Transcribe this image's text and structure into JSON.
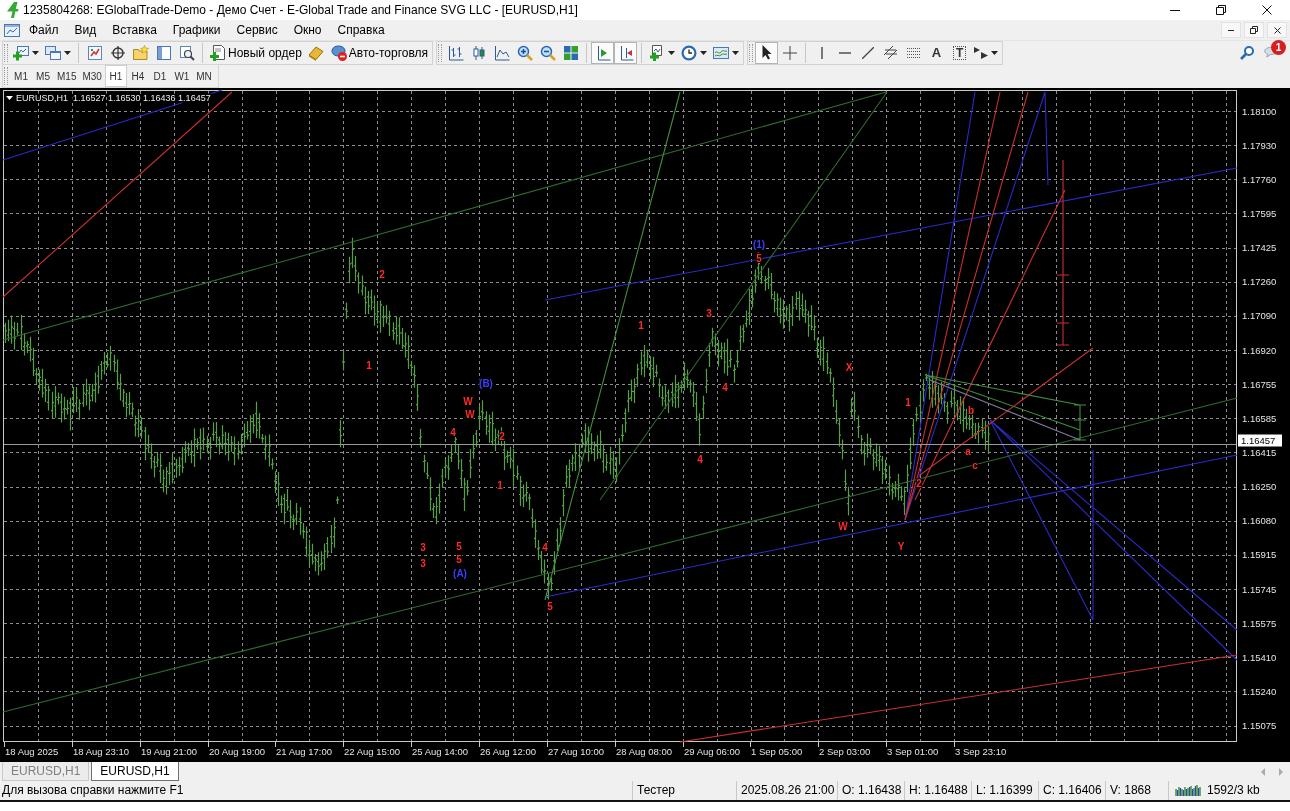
{
  "window": {
    "title": "1235804268: EGlobalTrade-Demo - Демо Счет - E-Global Trade and Finance SVG LLC - [EURUSD,H1]"
  },
  "menu": [
    "Файл",
    "Вид",
    "Вставка",
    "Графики",
    "Сервис",
    "Окно",
    "Справка"
  ],
  "toolbars": [
    {
      "groups": [
        [
          {
            "kind": "dropdown",
            "pressed": false
          },
          {
            "kind": "dropdown",
            "pressed": false
          }
        ],
        [
          {
            "kind": "icon",
            "pressed": false
          },
          {
            "kind": "icon",
            "pressed": false
          },
          {
            "kind": "icon",
            "pressed": false
          },
          {
            "kind": "icon",
            "pressed": false
          },
          {
            "kind": "icon",
            "pressed": false
          }
        ],
        [
          {
            "kind": "labelled",
            "label": "Новый ордер",
            "pressed": false
          },
          {
            "kind": "icon",
            "pressed": false
          },
          {
            "kind": "labelled",
            "label": "Авто-торговля",
            "pressed": false
          }
        ]
      ]
    },
    {
      "groups": [
        [
          {
            "kind": "icon",
            "pressed": false
          },
          {
            "kind": "icon",
            "pressed": false
          },
          {
            "kind": "icon",
            "pressed": false
          },
          {
            "kind": "icon",
            "pressed": false
          },
          {
            "kind": "icon",
            "pressed": false
          },
          {
            "kind": "icon",
            "pressed": false
          }
        ],
        [
          {
            "kind": "icon",
            "pressed": true
          },
          {
            "kind": "icon",
            "pressed": true
          }
        ],
        [
          {
            "kind": "dropdown",
            "pressed": false
          },
          {
            "kind": "dropdown",
            "pressed": false
          },
          {
            "kind": "dropdown",
            "pressed": false
          }
        ]
      ]
    },
    {
      "groups": [
        [
          {
            "kind": "icon",
            "pressed": true
          },
          {
            "kind": "icon",
            "pressed": false
          }
        ],
        [
          {
            "kind": "icon",
            "pressed": false
          },
          {
            "kind": "icon",
            "pressed": false
          },
          {
            "kind": "icon",
            "pressed": false
          },
          {
            "kind": "icon",
            "pressed": false
          },
          {
            "kind": "icon",
            "pressed": false
          },
          {
            "kind": "glyph",
            "label": "A",
            "pressed": false
          },
          {
            "kind": "boxed-glyph",
            "label": "T",
            "pressed": false
          },
          {
            "kind": "dropdown",
            "pressed": false
          }
        ]
      ]
    }
  ],
  "notifications": {
    "count": "1"
  },
  "timeframes": [
    {
      "label": "M1",
      "selected": false
    },
    {
      "label": "M5",
      "selected": false
    },
    {
      "label": "M15",
      "selected": false
    },
    {
      "label": "M30",
      "selected": false
    },
    {
      "label": "H1",
      "selected": true
    },
    {
      "label": "H4",
      "selected": false
    },
    {
      "label": "D1",
      "selected": false
    },
    {
      "label": "W1",
      "selected": false
    },
    {
      "label": "MN",
      "selected": false
    }
  ],
  "chart": {
    "symbol": "EURUSD,H1",
    "quotes": "1.16527 1.16530 1.16436 1.16457",
    "current_price": "1.16457",
    "price_labels": [
      "1.18100",
      "1.17930",
      "1.17760",
      "1.17595",
      "1.17425",
      "1.17260",
      "1.17090",
      "1.16920",
      "1.16755",
      "1.16585",
      "1.16415",
      "1.16250",
      "1.16080",
      "1.15915",
      "1.15745",
      "1.15575",
      "1.15410",
      "1.15240",
      "1.15075"
    ],
    "time_labels": [
      "18 Aug 2025",
      "18 Aug 23:10",
      "19 Aug 21:00",
      "20 Aug 19:00",
      "21 Aug 17:00",
      "22 Aug 15:00",
      "25 Aug 14:00",
      "26 Aug 12:00",
      "27 Aug 10:00",
      "28 Aug 08:00",
      "29 Aug 06:00",
      "1 Sep 05:00",
      "2 Sep 03:00",
      "3 Sep 01:00",
      "3 Sep 23:10"
    ],
    "wave_labels": [
      {
        "text": "1",
        "color": "#ff2a2a"
      },
      {
        "text": "2",
        "color": "#ff2a2a"
      },
      {
        "text": "3",
        "color": "#ff2a2a"
      },
      {
        "text": "3",
        "color": "#ff2a2a"
      },
      {
        "text": "W",
        "color": "#ff2a2a"
      },
      {
        "text": "W",
        "color": "#ff2a2a"
      },
      {
        "text": "4",
        "color": "#ff2a2a"
      },
      {
        "text": "5",
        "color": "#ff2a2a"
      },
      {
        "text": "5",
        "color": "#ff2a2a"
      },
      {
        "text": "(A)",
        "color": "#3c3cff"
      },
      {
        "text": "(B)",
        "color": "#3c3cff"
      },
      {
        "text": "1",
        "color": "#ff2a2a"
      },
      {
        "text": "2",
        "color": "#ff2a2a"
      },
      {
        "text": "4",
        "color": "#ff2a2a"
      },
      {
        "text": "5",
        "color": "#ff2a2a"
      },
      {
        "text": "1",
        "color": "#ff2a2a"
      },
      {
        "text": "4",
        "color": "#ff2a2a"
      },
      {
        "text": "3",
        "color": "#ff2a2a"
      },
      {
        "text": "4",
        "color": "#ff2a2a"
      },
      {
        "text": "(1)",
        "color": "#3c3cff"
      },
      {
        "text": "5",
        "color": "#ff2a2a"
      },
      {
        "text": "X",
        "color": "#ff2a2a"
      },
      {
        "text": "W",
        "color": "#ff2a2a"
      },
      {
        "text": "Y",
        "color": "#ff2a2a"
      },
      {
        "text": "1",
        "color": "#ff2a2a"
      },
      {
        "text": "2",
        "color": "#ff2a2a"
      },
      {
        "text": "a",
        "color": "#ff2a2a"
      },
      {
        "text": "b",
        "color": "#ff2a2a"
      },
      {
        "text": "c",
        "color": "#ff2a2a"
      }
    ]
  },
  "chart_tabs": [
    {
      "label": "EURUSD,H1",
      "selected": false
    },
    {
      "label": "EURUSD,H1",
      "selected": true
    }
  ],
  "status_bar": {
    "help": "Для вызова справки нажмите F1",
    "cells": [
      "Тестер",
      "2025.08.26 21:00",
      "O: 1.16438",
      "H: 1.16488",
      "L: 1.16399",
      "C: 1.16406",
      "V: 1868"
    ],
    "traffic": "1592/3 kb"
  }
}
